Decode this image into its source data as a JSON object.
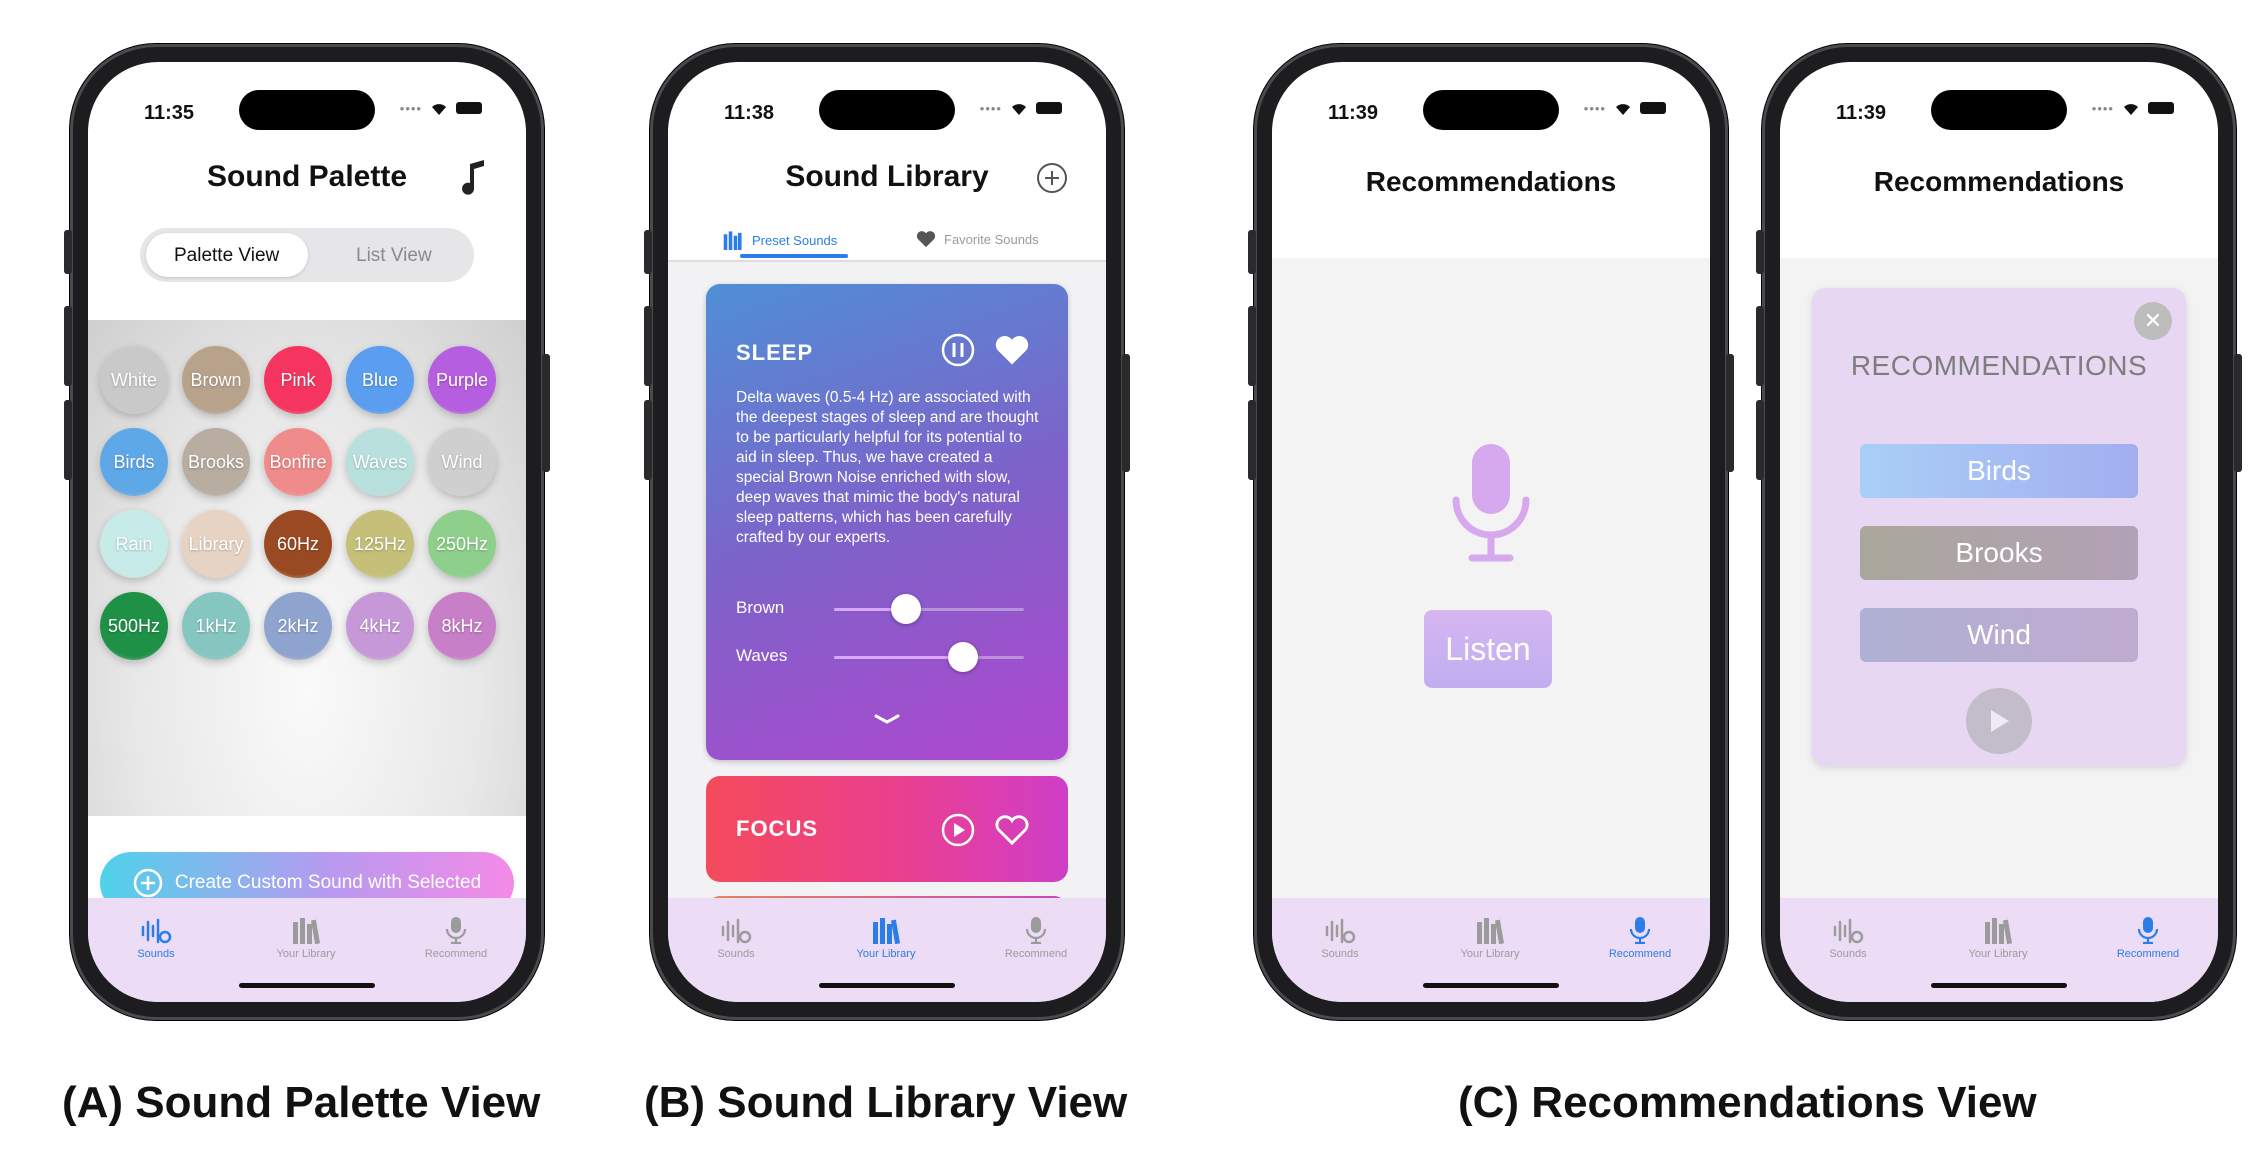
{
  "tabbar": {
    "items": [
      "Sounds",
      "Your Library",
      "Recommend"
    ]
  },
  "phone_a": {
    "time": "11:35",
    "title": "Sound Palette",
    "segment": [
      "Palette View",
      "List View"
    ],
    "circles": [
      {
        "label": "White",
        "color": "#c9c9c9"
      },
      {
        "label": "Brown",
        "color": "#b9a28c"
      },
      {
        "label": "Pink",
        "color": "#f5355f"
      },
      {
        "label": "Blue",
        "color": "#5b9ef0"
      },
      {
        "label": "Purple",
        "color": "#b55ee0"
      },
      {
        "label": "Birds",
        "color": "#5ea8e8"
      },
      {
        "label": "Brooks",
        "color": "#b8ada0"
      },
      {
        "label": "Bonfire",
        "color": "#ef8b8a"
      },
      {
        "label": "Waves",
        "color": "#b8e0dd"
      },
      {
        "label": "Wind",
        "color": "#cfcfcf"
      },
      {
        "label": "Rain",
        "color": "#c7ebe8"
      },
      {
        "label": "Library",
        "color": "#e6d3c3"
      },
      {
        "label": "60Hz",
        "color": "#9a4a22"
      },
      {
        "label": "125Hz",
        "color": "#c5bf7a"
      },
      {
        "label": "250Hz",
        "color": "#8fcf8c"
      },
      {
        "label": "500Hz",
        "color": "#1e9147"
      },
      {
        "label": "1kHz",
        "color": "#86c6c0"
      },
      {
        "label": "2kHz",
        "color": "#8fa3cf"
      },
      {
        "label": "4kHz",
        "color": "#c698d8"
      },
      {
        "label": "8kHz",
        "color": "#c77fc8"
      }
    ],
    "create_label": "Create Custom Sound with Selected"
  },
  "phone_b": {
    "time": "11:38",
    "title": "Sound Library",
    "tabs": [
      "Preset Sounds",
      "Favorite Sounds"
    ],
    "sleep": {
      "title": "SLEEP",
      "description": "Delta waves (0.5-4 Hz) are associated with the deepest stages of sleep and are thought to be particularly helpful for its potential to aid in sleep. Thus, we have created a special Brown Noise enriched with slow, deep waves that mimic the body's natural sleep patterns, which has been carefully crafted by our experts.",
      "sliders": [
        {
          "label": "Brown",
          "value": 0.38
        },
        {
          "label": "Waves",
          "value": 0.68
        }
      ]
    },
    "focus": {
      "title": "FOCUS"
    }
  },
  "phone_c1": {
    "time": "11:39",
    "title": "Recommendations",
    "listen_label": "Listen"
  },
  "phone_c2": {
    "time": "11:39",
    "title": "Recommendations",
    "modal_title": "RECOMMENDATIONS",
    "items": [
      "Birds",
      "Brooks",
      "Wind"
    ]
  },
  "captions": {
    "a": "(A) Sound Palette View",
    "b": "(B) Sound Library View",
    "c": "(C) Recommendations View"
  }
}
